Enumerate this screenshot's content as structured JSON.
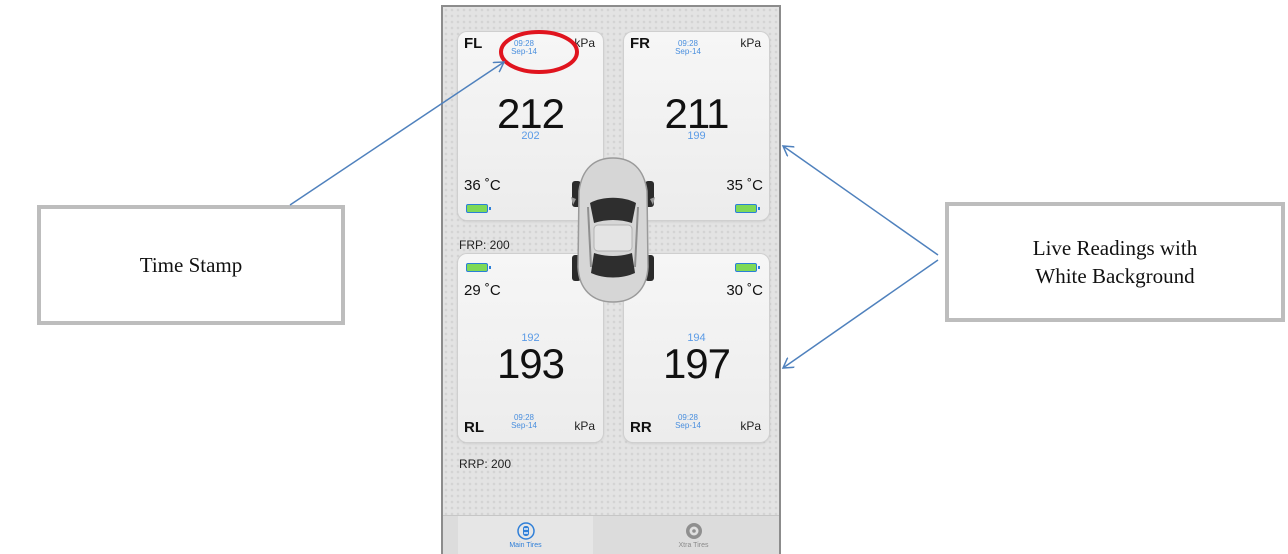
{
  "tires": {
    "fl": {
      "position": "FL",
      "time": "09:28",
      "date": "Sep-14",
      "unit": "kPa",
      "pressure": "212",
      "target": "202",
      "temp": "36 ˚C"
    },
    "fr": {
      "position": "FR",
      "time": "09:28",
      "date": "Sep-14",
      "unit": "kPa",
      "pressure": "211",
      "target": "199",
      "temp": "35 ˚C"
    },
    "rl": {
      "position": "RL",
      "time": "09:28",
      "date": "Sep-14",
      "unit": "kPa",
      "pressure": "193",
      "target": "192",
      "temp": "29 ˚C"
    },
    "rr": {
      "position": "RR",
      "time": "09:28",
      "date": "Sep-14",
      "unit": "kPa",
      "pressure": "197",
      "target": "194",
      "temp": "30 ˚C"
    }
  },
  "reference": {
    "front": "FRP:  200",
    "rear": "RRP:  200"
  },
  "tabs": [
    {
      "label": "Main Tires",
      "icon": "car-top-icon",
      "active": true
    },
    {
      "label": "Xtra Tires",
      "icon": "tire-icon",
      "active": false
    }
  ],
  "annotations": {
    "time_stamp": "Time Stamp",
    "live_line1": "Live Readings with",
    "live_line2": "White Background"
  },
  "colors": {
    "accent": "#4a8fde",
    "battery": "#7ed957",
    "highlight_circle": "#e0141e",
    "arrow": "#4f81bd",
    "callout_border": "#bdbdbd"
  }
}
